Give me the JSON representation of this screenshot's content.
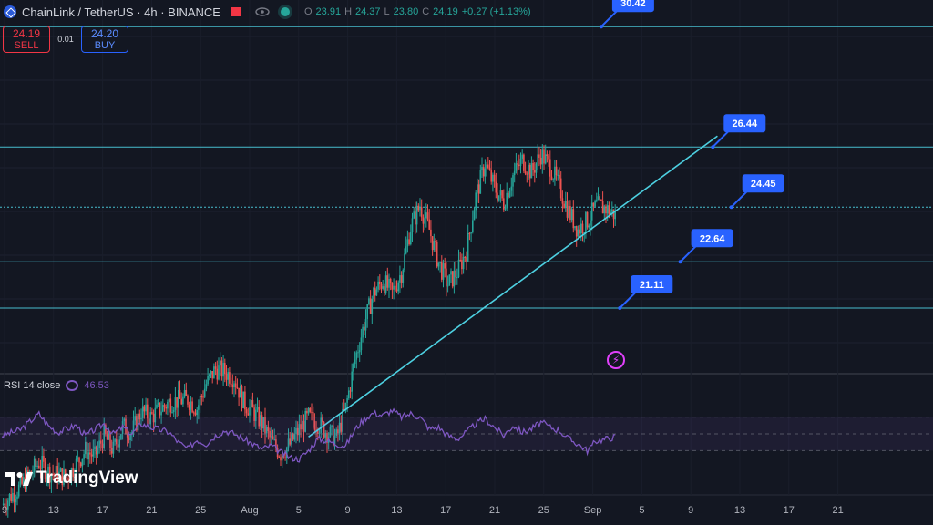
{
  "header": {
    "symbol_title": "ChainLink / TetherUS · 4h · BINANCE",
    "ohlc": {
      "o_label": "O",
      "o": "23.91",
      "h_label": "H",
      "h": "24.37",
      "l_label": "L",
      "l": "23.80",
      "c_label": "C",
      "c": "24.19",
      "change": "+0.27 (+1.13%)"
    }
  },
  "trade": {
    "sell_price": "24.19",
    "sell_label": "SELL",
    "spread": "0.01",
    "buy_price": "24.20",
    "buy_label": "BUY"
  },
  "rsi": {
    "label": "RSI 14 close",
    "value": "46.53"
  },
  "logo": {
    "text": "TradingView"
  },
  "colors": {
    "background": "#131722",
    "up": "#26a69a",
    "down": "#ef5350",
    "level_line": "#4dd0e1",
    "callout": "#2962ff",
    "rsi_line": "#7e57c2"
  },
  "chart_data": {
    "type": "candlestick",
    "price_range": [
      19.0,
      31.3
    ],
    "x_ticks": [
      "9",
      "13",
      "17",
      "21",
      "25",
      "Aug",
      "5",
      "9",
      "13",
      "17",
      "21",
      "25",
      "Sep",
      "5",
      "9",
      "13",
      "17",
      "21"
    ],
    "close_path": [
      [
        0,
        14.6
      ],
      [
        2,
        15.2
      ],
      [
        4,
        16.0
      ],
      [
        5,
        15.7
      ],
      [
        7,
        15.5
      ],
      [
        9,
        16.4
      ],
      [
        10,
        16.2
      ],
      [
        11,
        16.9
      ],
      [
        12,
        16.4
      ],
      [
        13,
        17.2
      ],
      [
        14,
        17.0
      ],
      [
        15,
        17.7
      ],
      [
        16,
        17.5
      ],
      [
        18,
        18.0
      ],
      [
        20,
        18.1
      ],
      [
        21,
        17.8
      ],
      [
        22,
        18.6
      ],
      [
        23,
        19.1
      ],
      [
        24,
        19.0
      ],
      [
        25,
        18.8
      ],
      [
        26,
        18.0
      ],
      [
        27,
        17.7
      ],
      [
        28,
        17.3
      ],
      [
        29,
        16.7
      ],
      [
        30,
        16.3
      ],
      [
        31,
        16.6
      ],
      [
        32,
        17.1
      ],
      [
        33,
        17.5
      ],
      [
        34,
        17.3
      ],
      [
        35,
        17.0
      ],
      [
        36,
        16.8
      ],
      [
        37,
        17.8
      ],
      [
        38,
        19.4
      ],
      [
        39,
        20.6
      ],
      [
        40,
        21.6
      ],
      [
        41,
        22.0
      ],
      [
        42,
        21.6
      ],
      [
        43,
        22.3
      ],
      [
        44,
        23.8
      ],
      [
        45,
        24.5
      ],
      [
        46,
        23.7
      ],
      [
        47,
        22.6
      ],
      [
        48,
        21.9
      ],
      [
        49,
        22.3
      ],
      [
        50,
        23.0
      ],
      [
        51,
        24.8
      ],
      [
        52,
        25.9
      ],
      [
        53,
        25.1
      ],
      [
        54,
        24.6
      ],
      [
        55,
        25.5
      ],
      [
        56,
        26.0
      ],
      [
        57,
        25.6
      ],
      [
        58,
        26.2
      ],
      [
        59,
        25.8
      ],
      [
        60,
        25.1
      ],
      [
        61,
        24.3
      ],
      [
        62,
        23.7
      ],
      [
        63,
        24.0
      ],
      [
        64,
        24.5
      ],
      [
        65,
        24.4
      ],
      [
        66,
        24.19
      ]
    ],
    "levels": [
      {
        "name": "level-30.42",
        "price": 30.42,
        "label": "30.42",
        "x_start": 0,
        "x_end": 96,
        "anchor": 64.5
      },
      {
        "name": "level-26.44",
        "price": 26.44,
        "label": "26.44",
        "x_start": 0,
        "x_end": 96,
        "anchor": 76.5
      },
      {
        "name": "level-24.45",
        "price": 24.45,
        "label": "24.45",
        "x_start": 0,
        "x_end": 96,
        "anchor": 78.5,
        "dotted": true
      },
      {
        "name": "level-22.64",
        "price": 22.64,
        "label": "22.64",
        "x_start": 0,
        "x_end": 96,
        "anchor": 73
      },
      {
        "name": "level-21.11",
        "price": 21.11,
        "label": "21.11",
        "x_start": 0,
        "x_end": 96,
        "anchor": 66.5
      }
    ],
    "trendline": {
      "from": [
        33,
        16.85
      ],
      "to": [
        77,
        26.8
      ]
    },
    "rsi": {
      "range": [
        0,
        100
      ],
      "levels": [
        70,
        50,
        30
      ],
      "path": [
        [
          0,
          48
        ],
        [
          2,
          55
        ],
        [
          4,
          74
        ],
        [
          5,
          60
        ],
        [
          6,
          52
        ],
        [
          8,
          60
        ],
        [
          9,
          48
        ],
        [
          10,
          55
        ],
        [
          11,
          62
        ],
        [
          12,
          50
        ],
        [
          13,
          58
        ],
        [
          14,
          50
        ],
        [
          15,
          62
        ],
        [
          16,
          58
        ],
        [
          18,
          52
        ],
        [
          19,
          40
        ],
        [
          20,
          32
        ],
        [
          21,
          43
        ],
        [
          22,
          38
        ],
        [
          23,
          48
        ],
        [
          24,
          54
        ],
        [
          25,
          50
        ],
        [
          26,
          44
        ],
        [
          27,
          38
        ],
        [
          28,
          32
        ],
        [
          29,
          36
        ],
        [
          30,
          28
        ],
        [
          31,
          22
        ],
        [
          32,
          20
        ],
        [
          33,
          30
        ],
        [
          34,
          44
        ],
        [
          35,
          42
        ],
        [
          36,
          38
        ],
        [
          37,
          36
        ],
        [
          38,
          55
        ],
        [
          39,
          68
        ],
        [
          40,
          75
        ],
        [
          41,
          72
        ],
        [
          42,
          78
        ],
        [
          43,
          70
        ],
        [
          44,
          74
        ],
        [
          45,
          70
        ],
        [
          46,
          56
        ],
        [
          47,
          58
        ],
        [
          48,
          48
        ],
        [
          49,
          44
        ],
        [
          50,
          52
        ],
        [
          51,
          62
        ],
        [
          52,
          68
        ],
        [
          53,
          58
        ],
        [
          54,
          48
        ],
        [
          55,
          60
        ],
        [
          56,
          52
        ],
        [
          57,
          56
        ],
        [
          58,
          64
        ],
        [
          59,
          58
        ],
        [
          60,
          54
        ],
        [
          61,
          44
        ],
        [
          62,
          38
        ],
        [
          63,
          30
        ],
        [
          64,
          42
        ],
        [
          65,
          44
        ],
        [
          66,
          46.53
        ]
      ]
    }
  }
}
